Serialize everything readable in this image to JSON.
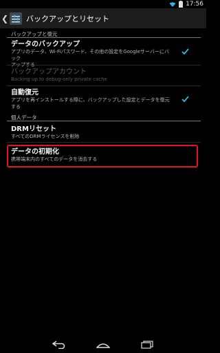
{
  "status": {
    "time": "17:56"
  },
  "actionbar": {
    "title": "バックアップとリセット"
  },
  "sections": {
    "backup": "バックアップと復元",
    "personal": "個人データ"
  },
  "items": {
    "data_backup": {
      "title": "データのバックアップ",
      "sub1": "アプリのデータ、Wi-Fiパスワード、その他の設定をGoogleサーバーにバック",
      "sub2": "アップする",
      "checked": true
    },
    "backup_account": {
      "title": "バックアップアカウント",
      "sub": "Backing up to debug-only private cache"
    },
    "auto_restore": {
      "title": "自動復元",
      "sub1": "アプリを再インストールする際に、バックアップした設定とデータを復元",
      "sub2": "する",
      "checked": true
    },
    "drm_reset": {
      "title": "DRMリセット",
      "sub": "すべてのDRMライセンスを削除"
    },
    "factory_reset": {
      "title": "データの初期化",
      "sub": "携帯端末内のすべてのデータを消去する"
    }
  },
  "icons": {
    "back": "back-icon",
    "home": "home-icon",
    "recents": "recents-icon"
  },
  "colors": {
    "highlight": "#e81227",
    "accent": "#33b5e5"
  }
}
